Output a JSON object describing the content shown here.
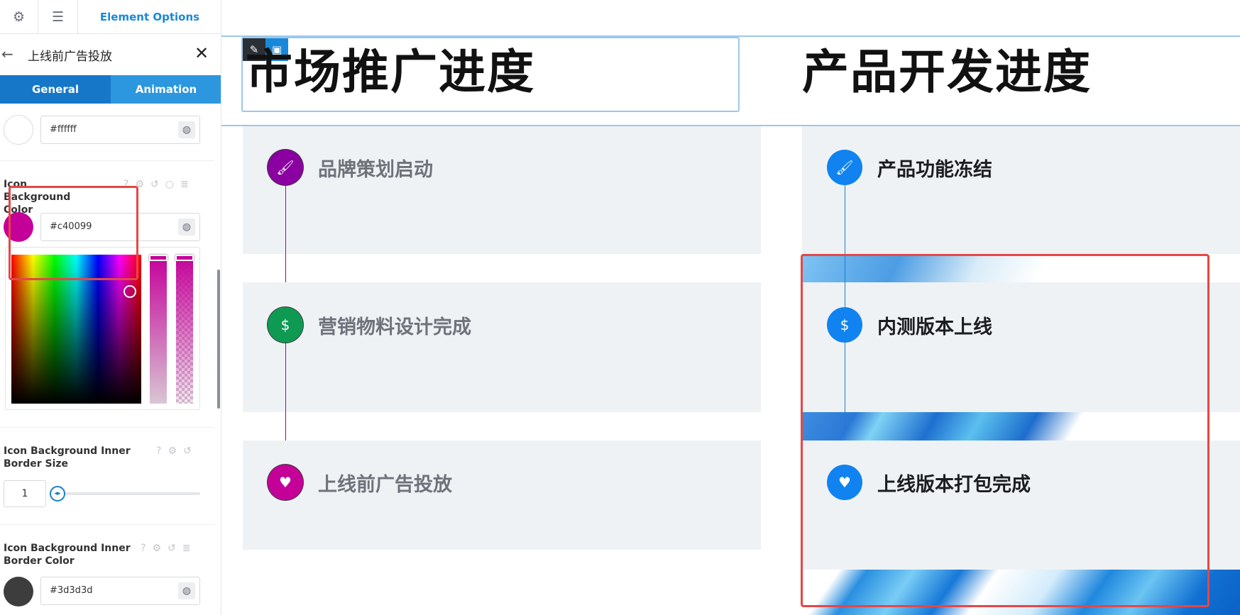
{
  "panel": {
    "top_title": "Element Options",
    "header_title": "上线前广告投放",
    "tabs": [
      "General",
      "Animation"
    ],
    "fields": {
      "prev_color_value": "#ffffff",
      "icon_bg_label": "Icon Background Color",
      "icon_bg_value": "#c40099",
      "inner_border_size_label": "Icon Background Inner Border Size",
      "inner_border_size_value": "1",
      "inner_border_color_label": "Icon Background Inner Border Color",
      "inner_border_color_value": "#3d3d3d"
    }
  },
  "canvas": {
    "left_heading": "市场推广进度",
    "right_heading": "产品开发进度",
    "left_items": [
      {
        "title": "品牌策划启动",
        "icon": "paintbrush-icon",
        "color": "#8a00a0"
      },
      {
        "title": "营销物料设计完成",
        "icon": "invoice-icon",
        "color": "#0e9a53"
      },
      {
        "title": "上线前广告投放",
        "icon": "heart-icons",
        "color": "#c40099"
      }
    ],
    "right_items": [
      {
        "title": "产品功能冻结",
        "icon": "paintbrush-icon",
        "color": "#1083f0"
      },
      {
        "title": "内测版本上线",
        "icon": "invoice-icon",
        "color": "#1083f0"
      },
      {
        "title": "上线版本打包完成",
        "icon": "heart-icons",
        "color": "#1083f0"
      }
    ]
  },
  "colors": {
    "accent": "#1a88d8",
    "highlight": "#e64646"
  }
}
